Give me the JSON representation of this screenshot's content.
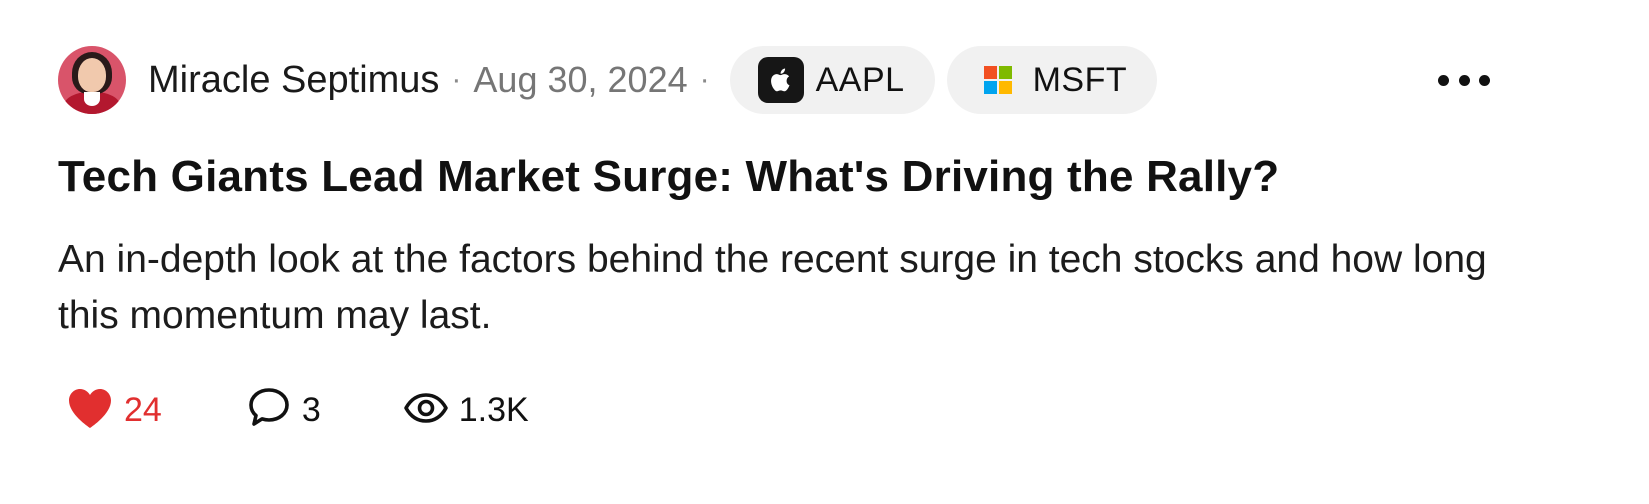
{
  "post": {
    "author": "Miracle Septimus",
    "separator": "·",
    "date": "Aug 30, 2024",
    "tickers": [
      {
        "symbol": "AAPL",
        "icon": "apple-icon"
      },
      {
        "symbol": "MSFT",
        "icon": "microsoft-icon"
      }
    ],
    "title": "Tech Giants Lead Market Surge: What's Driving the Rally?",
    "summary": "An in-depth look at the factors behind the recent surge in tech stocks and how long this momentum may last.",
    "stats": {
      "likes": "24",
      "comments": "3",
      "views": "1.3K"
    }
  },
  "colors": {
    "like_red": "#e12f2f",
    "chip_background": "#f1f1f1",
    "muted_text": "#767676"
  }
}
